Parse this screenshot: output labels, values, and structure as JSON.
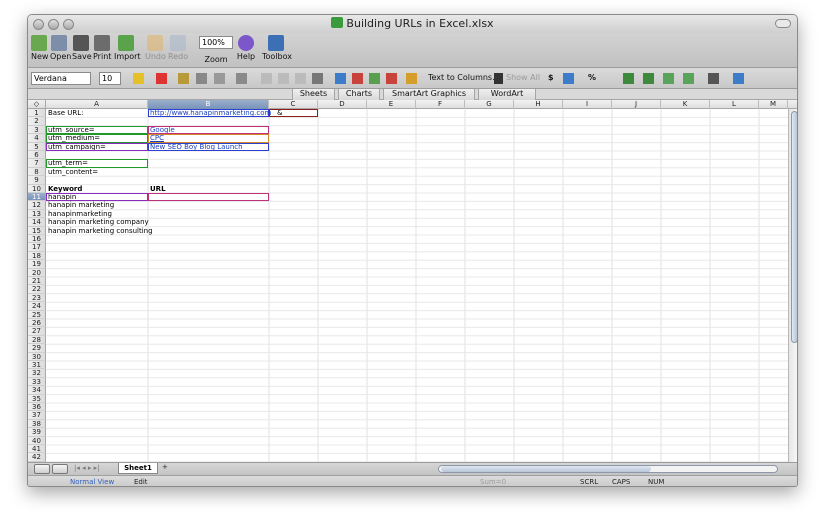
{
  "window": {
    "title": "Building URLs in Excel.xlsx"
  },
  "toolbar": {
    "new": "New",
    "open": "Open",
    "save": "Save",
    "print": "Print",
    "import": "Import",
    "undo": "Undo",
    "redo": "Redo",
    "zoom_value": "100%",
    "zoom": "Zoom",
    "help": "Help",
    "toolbox": "Toolbox"
  },
  "format_bar": {
    "font": "Verdana",
    "size": "10",
    "text_to_columns": "Text to Columns...",
    "show_all": "Show All",
    "currency": "$",
    "percent": "%"
  },
  "ribbon_tabs": [
    "Sheets",
    "Charts",
    "SmartArt Graphics",
    "WordArt"
  ],
  "columns": [
    "A",
    "B",
    "C",
    "D",
    "E",
    "F",
    "G",
    "H",
    "I",
    "J",
    "K",
    "L",
    "M"
  ],
  "rows": [
    "1",
    "2",
    "3",
    "4",
    "5",
    "6",
    "7",
    "8",
    "9",
    "10",
    "11",
    "12",
    "13",
    "14",
    "15",
    "16",
    "17",
    "18",
    "19",
    "20",
    "21",
    "22",
    "23",
    "24",
    "25",
    "26",
    "27",
    "28",
    "29",
    "30",
    "31",
    "32",
    "33",
    "34",
    "35",
    "36",
    "37",
    "38",
    "39",
    "40",
    "41",
    "42"
  ],
  "cells": {
    "a1": "Base URL:",
    "b1": "http://www.hanapinmarketing.com",
    "c1": "&",
    "a3": "utm_source=",
    "b3": "Google",
    "a4": "utm_medium=",
    "b4": "CPC",
    "a5": "utm_campaign=",
    "b5": "New SEO Boy Blog Launch",
    "a7": "utm_term=",
    "a8": "utm_content=",
    "a10": "Keyword",
    "b10": "URL",
    "a11": "hanapin",
    "a12": "hanapin marketing",
    "a13": "hanapinmarketing",
    "a14": "hanapin marketing company",
    "a15": "hanapin marketing consulting"
  },
  "sheet_tab": "Sheet1",
  "status": {
    "view": "Normal View",
    "mode": "Edit",
    "sum": "Sum=0",
    "scrl": "SCRL",
    "caps": "CAPS",
    "num": "NUM"
  }
}
